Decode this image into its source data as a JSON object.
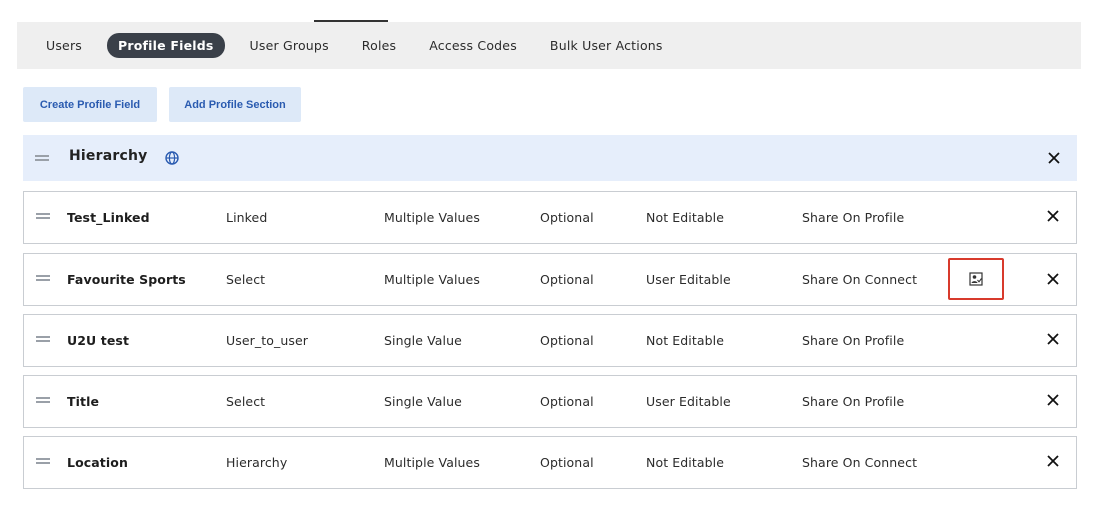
{
  "tabs": [
    {
      "label": "Users",
      "active": false
    },
    {
      "label": "Profile Fields",
      "active": true
    },
    {
      "label": "User Groups",
      "active": false
    },
    {
      "label": "Roles",
      "active": false
    },
    {
      "label": "Access Codes",
      "active": false
    },
    {
      "label": "Bulk User Actions",
      "active": false
    }
  ],
  "actions": {
    "create_label": "Create Profile Field",
    "add_section_label": "Add Profile Section"
  },
  "section": {
    "title": "Hierarchy",
    "icon": "globe-icon"
  },
  "rows": [
    {
      "name": "Test_Linked",
      "type": "Linked",
      "values": "Multiple Values",
      "required": "Optional",
      "editable": "Not Editable",
      "share": "Share On Profile",
      "highlighted_icon": false
    },
    {
      "name": "Favourite Sports",
      "type": "Select",
      "values": "Multiple Values",
      "required": "Optional",
      "editable": "User Editable",
      "share": "Share On Connect",
      "highlighted_icon": true
    },
    {
      "name": "U2U test",
      "type": "User_to_user",
      "values": "Single Value",
      "required": "Optional",
      "editable": "Not Editable",
      "share": "Share On Profile",
      "highlighted_icon": false
    },
    {
      "name": "Title",
      "type": "Select",
      "values": "Single Value",
      "required": "Optional",
      "editable": "User Editable",
      "share": "Share On Profile",
      "highlighted_icon": false
    },
    {
      "name": "Location",
      "type": "Hierarchy",
      "values": "Multiple Values",
      "required": "Optional",
      "editable": "Not Editable",
      "share": "Share On Connect",
      "highlighted_icon": false
    }
  ],
  "colors": {
    "active_tab_bg": "#3a4049",
    "button_bg": "#dde9f8",
    "button_text": "#2a5bb0",
    "section_bg": "#e6eefb",
    "highlight_border": "#d83a2c"
  }
}
